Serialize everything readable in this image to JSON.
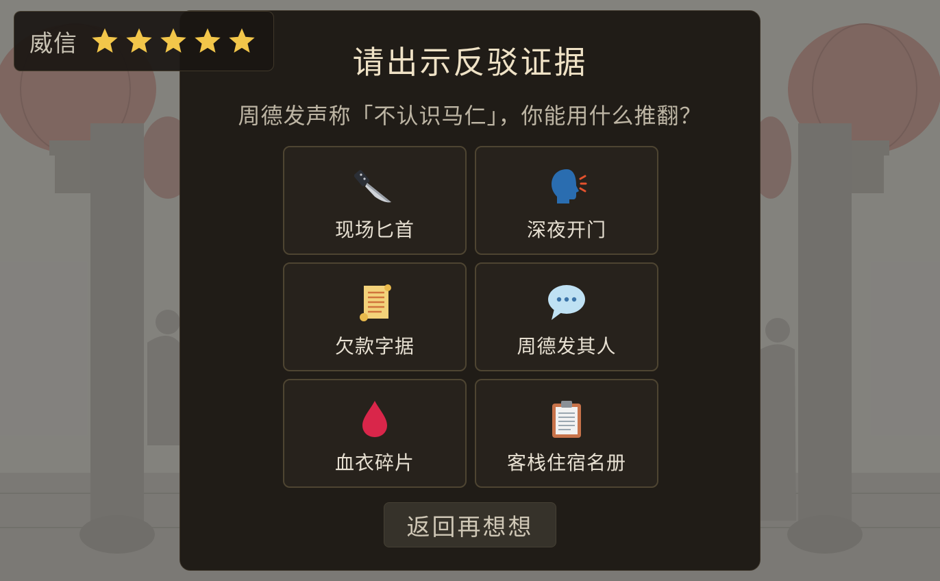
{
  "reputation": {
    "label": "威信",
    "stars_filled": 5,
    "stars_total": 5,
    "star_color": "#f2c64a"
  },
  "modal": {
    "title": "请出示反驳证据",
    "subtitle": "周德发声称「不认识马仁」，你能用什么推翻？",
    "evidence": [
      {
        "label": "现场匕首",
        "icon": "knife-icon"
      },
      {
        "label": "深夜开门",
        "icon": "speaking-head-icon"
      },
      {
        "label": "欠款字据",
        "icon": "scroll-icon"
      },
      {
        "label": "周德发其人",
        "icon": "speech-bubble-icon"
      },
      {
        "label": "血衣碎片",
        "icon": "blood-drop-icon"
      },
      {
        "label": "客栈住宿名册",
        "icon": "clipboard-icon"
      }
    ],
    "back_label": "返回再想想"
  },
  "colors": {
    "title": "#efe2c6",
    "modal_bg": "#201c17",
    "card_border": "#4e4532"
  }
}
